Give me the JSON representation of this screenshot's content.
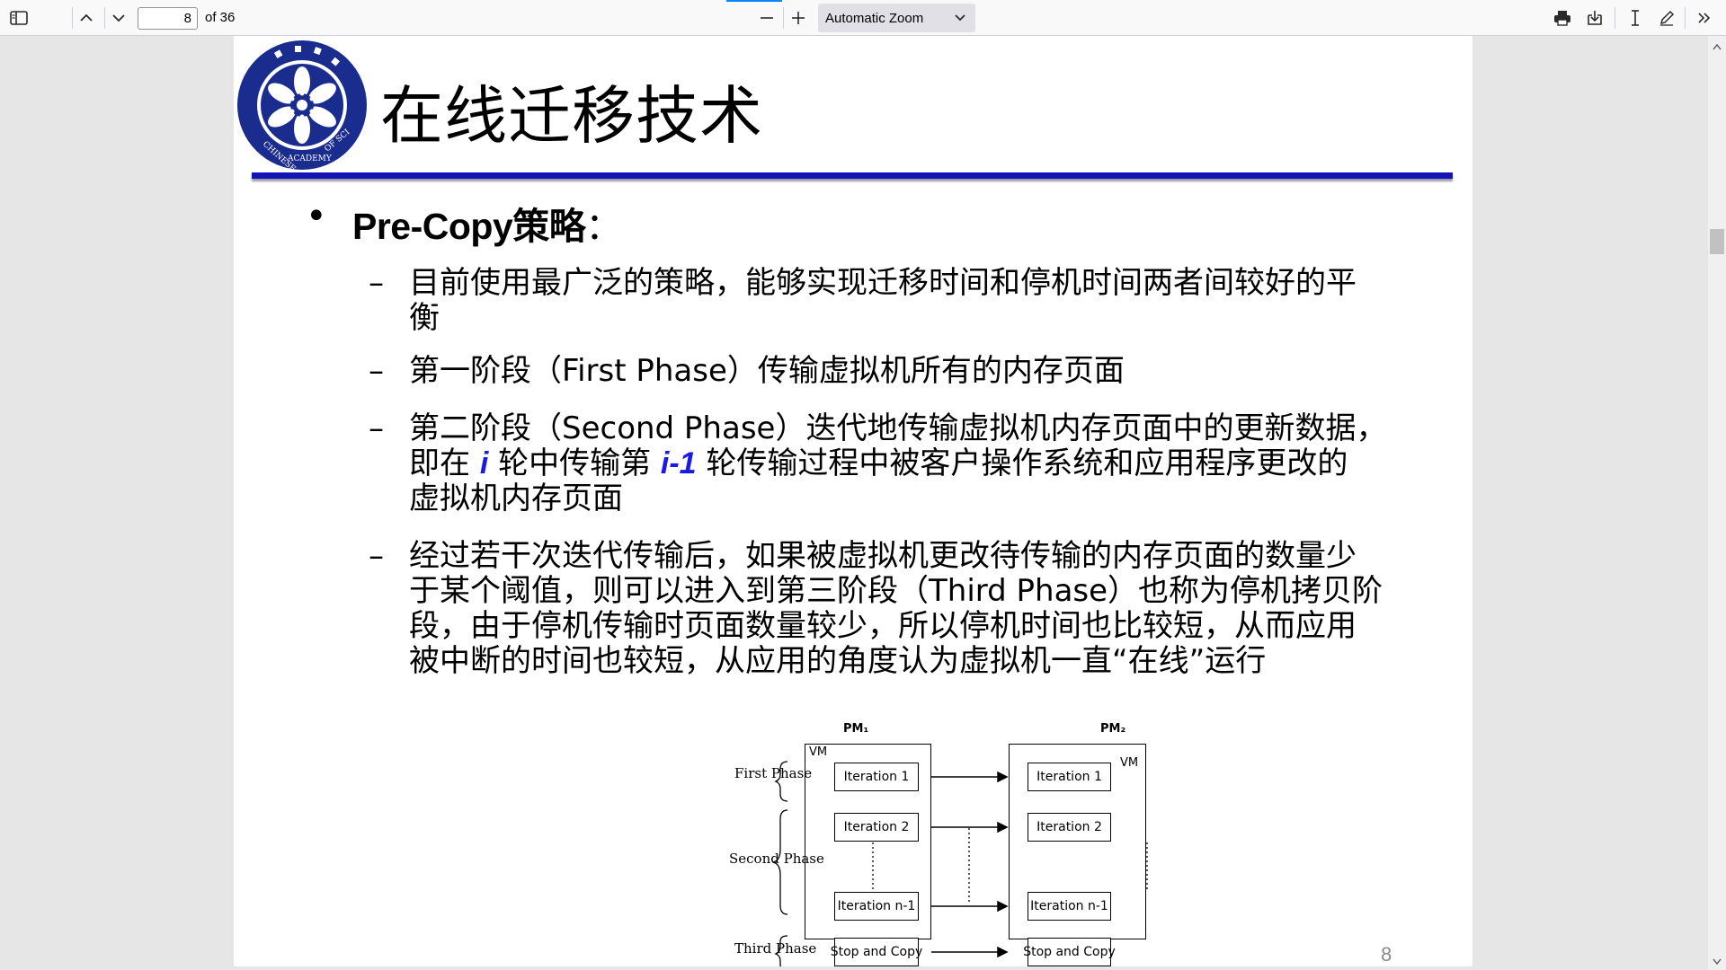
{
  "toolbar": {
    "page_number": "8",
    "page_count": "of 36",
    "zoom": "Automatic Zoom"
  },
  "slide": {
    "title": "在线迁移技术",
    "bullet": {
      "label": "Pre-Copy策略",
      "colon": "："
    },
    "items": [
      {
        "lines": [
          "目前使用最广泛的策略，能够实现迁移时间和停机时间两者间较好的平",
          "衡"
        ]
      },
      {
        "lines": [
          "第一阶段（First Phase）传输虚拟机所有的内存页面"
        ]
      },
      {
        "line1": "第二阶段（Second Phase）迭代地传输虚拟机内存页面中的更新数据，",
        "line2_a": "即在 ",
        "line2_em1": "i",
        "line2_b": " 轮中传输第 ",
        "line2_em2": "i-1",
        "line2_c": " 轮传输过程中被客户操作系统和应用程序更改的",
        "line3": "虚拟机内存页面"
      },
      {
        "lines": [
          "经过若干次迭代传输后，如果被虚拟机更改待传输的内存页面的数量少",
          "于某个阈值，则可以进入到第三阶段（Third Phase）也称为停机拷贝阶",
          "段，由于停机传输时页面数量较少，所以停机时间也比较短，从而应用",
          "被中断的时间也较短，从应用的角度认为虚拟机一直“在线”运行"
        ]
      }
    ],
    "page_number": "8"
  },
  "diagram": {
    "pm1": "PM₁",
    "pm2": "PM₂",
    "vm": "VM",
    "phases": [
      "First Phase",
      "Second Phase",
      "Third Phase"
    ],
    "iterations": [
      "Iteration 1",
      "Iteration 2",
      "Iteration n-1",
      "Stop and Copy"
    ]
  },
  "icons": [
    "sidebar-toggle-icon",
    "chevron-up-icon",
    "chevron-down-icon",
    "zoom-out-icon",
    "zoom-in-icon",
    "print-icon",
    "download-icon",
    "text-cursor-icon",
    "pen-icon",
    "double-chevron-right-icon"
  ],
  "colors": {
    "title_rule": "#1313b8",
    "emphasis": "#1a1ae6",
    "logo": "#1b2c8f"
  }
}
